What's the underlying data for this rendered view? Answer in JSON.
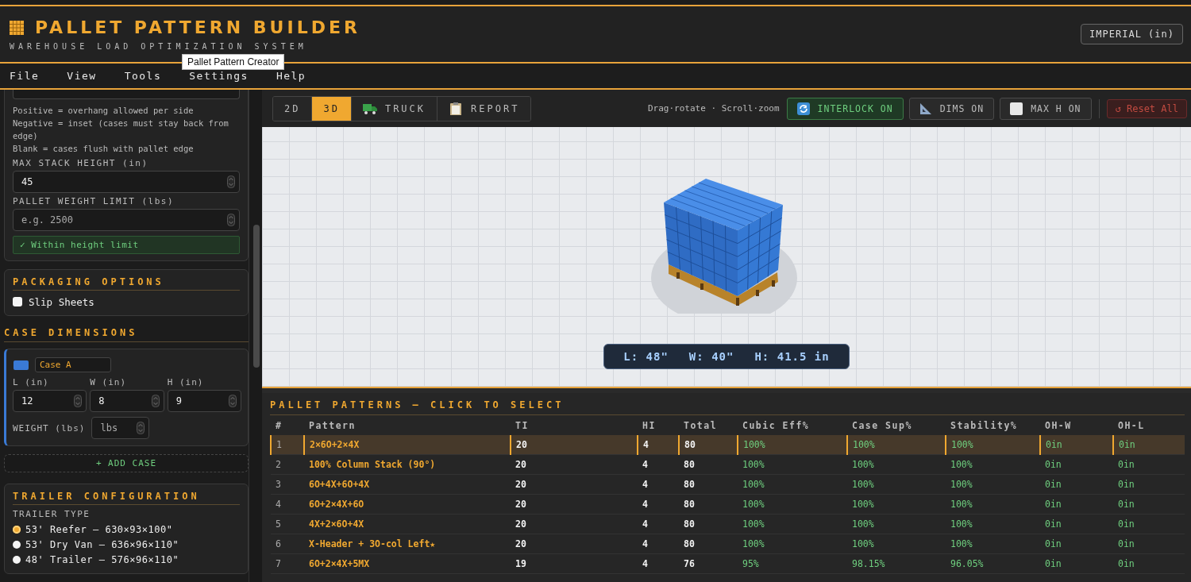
{
  "header": {
    "title": "PALLET PATTERN BUILDER",
    "subtitle": "WAREHOUSE LOAD OPTIMIZATION SYSTEM",
    "unit_button": "IMPERIAL (in)",
    "tooltip": "Pallet Pattern Creator"
  },
  "menu": [
    "File",
    "View",
    "Tools",
    "Settings",
    "Help"
  ],
  "sidebar": {
    "overhang_help": [
      "Positive = overhang allowed per side",
      "Negative = inset (cases must stay back from edge)",
      "Blank = cases flush with pallet edge"
    ],
    "fields": [
      {
        "label": "MAX STACK HEIGHT (in)",
        "value": "45"
      },
      {
        "label": "PALLET WEIGHT LIMIT (lbs)",
        "placeholder": "e.g. 2500"
      }
    ],
    "status": "✓ Within height limit",
    "packaging": {
      "title": "PACKAGING OPTIONS",
      "options": [
        {
          "label": "Slip Sheets",
          "checked": false
        }
      ]
    },
    "case_dimensions": {
      "title": "CASE DIMENSIONS",
      "cases": [
        {
          "color": "#3a7ad6",
          "name": "Case A",
          "dims": [
            {
              "label": "L (in)",
              "value": "12"
            },
            {
              "label": "W (in)",
              "value": "8"
            },
            {
              "label": "H (in)",
              "value": "9"
            }
          ],
          "weight_label": "WEIGHT (lbs)",
          "weight_placeholder": "lbs"
        }
      ],
      "add_button": "+ ADD CASE"
    },
    "trailer": {
      "title": "TRAILER CONFIGURATION",
      "type_label": "TRAILER TYPE",
      "options": [
        {
          "label": "53' Reefer – 630×93×100\"",
          "selected": true
        },
        {
          "label": "53' Dry Van – 636×96×110\"",
          "selected": false
        },
        {
          "label": "48' Trailer – 576×96×110\"",
          "selected": false
        }
      ]
    }
  },
  "toolbar": {
    "view_tabs": [
      {
        "label": "2D",
        "kind": "plain",
        "selected": false
      },
      {
        "label": "3D",
        "kind": "plain",
        "selected": true
      },
      {
        "label": "TRUCK",
        "kind": "truck",
        "selected": false
      },
      {
        "label": "REPORT",
        "kind": "report",
        "selected": false
      }
    ],
    "hint": "Drag·rotate · Scroll·zoom",
    "toggles": [
      {
        "label": "INTERLOCK ON",
        "kind": "interlock",
        "highlighted": true
      },
      {
        "label": "DIMS ON",
        "kind": "dims",
        "highlighted": false
      },
      {
        "label": "MAX H ON",
        "kind": "maxh",
        "highlighted": false
      }
    ],
    "reset_button": "↺ Reset All"
  },
  "viewport": {
    "readout": [
      "L: 48\"",
      "W: 40\"",
      "H: 41.5 in"
    ]
  },
  "table": {
    "title": "PALLET PATTERNS — CLICK TO SELECT",
    "columns": [
      "#",
      "Pattern",
      "TI",
      "HI",
      "Total",
      "Cubic Eff%",
      "Case Sup%",
      "Stability%",
      "OH-W",
      "OH-L"
    ],
    "rows": [
      {
        "selected": true,
        "cells": [
          "1",
          "2×6O+2×4X",
          "20",
          "4",
          "80",
          "100%",
          "100%",
          "100%",
          "0in",
          "0in"
        ]
      },
      {
        "selected": false,
        "cells": [
          "2",
          "100% Column Stack (90°)",
          "20",
          "4",
          "80",
          "100%",
          "100%",
          "100%",
          "0in",
          "0in"
        ]
      },
      {
        "selected": false,
        "cells": [
          "3",
          "6O+4X+6O+4X",
          "20",
          "4",
          "80",
          "100%",
          "100%",
          "100%",
          "0in",
          "0in"
        ]
      },
      {
        "selected": false,
        "cells": [
          "4",
          "6O+2×4X+6O",
          "20",
          "4",
          "80",
          "100%",
          "100%",
          "100%",
          "0in",
          "0in"
        ]
      },
      {
        "selected": false,
        "cells": [
          "5",
          "4X+2×6O+4X",
          "20",
          "4",
          "80",
          "100%",
          "100%",
          "100%",
          "0in",
          "0in"
        ]
      },
      {
        "selected": false,
        "cells": [
          "6",
          "X-Header + 3O-col Left★",
          "20",
          "4",
          "80",
          "100%",
          "100%",
          "100%",
          "0in",
          "0in"
        ]
      },
      {
        "selected": false,
        "cells": [
          "7",
          "6O+2×4X+5MX",
          "19",
          "4",
          "76",
          "95%",
          "98.15%",
          "96.05%",
          "0in",
          "0in"
        ]
      }
    ]
  }
}
